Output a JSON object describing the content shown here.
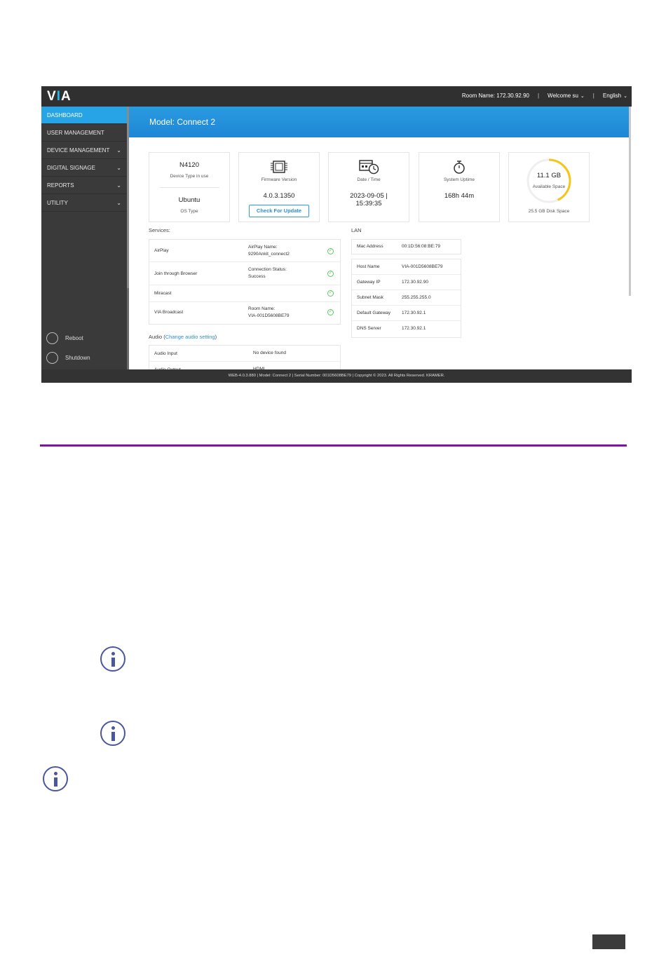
{
  "header": {
    "logo": "VIA",
    "room_name": "Room Name: 172.30.92.90",
    "separator": "|",
    "welcome": "Welcome su",
    "language": "English"
  },
  "sidebar": {
    "items": [
      {
        "label": "DASHBOARD",
        "active": true,
        "expandable": false
      },
      {
        "label": "USER MANAGEMENT",
        "active": false,
        "expandable": false
      },
      {
        "label": "DEVICE MANAGEMENT",
        "active": false,
        "expandable": true
      },
      {
        "label": "DIGITAL SIGNAGE",
        "active": false,
        "expandable": true
      },
      {
        "label": "REPORTS",
        "active": false,
        "expandable": true
      },
      {
        "label": "UTILITY",
        "active": false,
        "expandable": true
      }
    ],
    "reboot": "Reboot",
    "shutdown": "Shutdown"
  },
  "main": {
    "title": "Model: Connect 2",
    "cards": {
      "device": {
        "value": "N4120",
        "label": "Device Type in use",
        "os_value": "Ubuntu",
        "os_label": "OS Type"
      },
      "firmware": {
        "label": "Firmware Version",
        "value": "4.0.3.1350",
        "button": "Check For Update"
      },
      "datetime": {
        "label": "Date / Time",
        "line1": "2023-09-05 |",
        "line2": "15:39:35"
      },
      "uptime": {
        "label": "System Uptime",
        "value": "168h 44m"
      },
      "disk": {
        "available": "11.1 GB",
        "available_label": "Available Space",
        "total": "25.5 GB Disk Space",
        "used_fraction": 0.43
      }
    },
    "services": {
      "title": "Services:",
      "rows": [
        {
          "name": "AirPlay",
          "detail1": "AirPlay Name:",
          "detail2": "9290Ankit_connect2"
        },
        {
          "name": "Join through Browser",
          "detail1": "Connection Status:",
          "detail2": "Success"
        },
        {
          "name": "Miracast",
          "detail1": "",
          "detail2": ""
        },
        {
          "name": "VIA Broadcast",
          "detail1": "Room Name:",
          "detail2": "VIA-001D5608BE79"
        }
      ]
    },
    "audio": {
      "title": "Audio (",
      "link": "Change audio setting",
      "title_end": ")",
      "rows": [
        {
          "name": "Audio Input",
          "value": "No device found"
        },
        {
          "name": "Audio Output",
          "value": "HDMI"
        }
      ]
    },
    "lan": {
      "title": "LAN",
      "mac_label": "Mac Address",
      "mac_value": "00:1D:56:08:BE:79",
      "rows": [
        {
          "key": "Host Name",
          "value": "VIA-001D5608BE79"
        },
        {
          "key": "Gateway IP",
          "value": "172.30.92.90"
        },
        {
          "key": "Subnet Mask",
          "value": "255.255.255.0"
        },
        {
          "key": "Default Gateway",
          "value": "172.30.92.1"
        },
        {
          "key": "DNS Server",
          "value": "172.30.92.1"
        }
      ]
    }
  },
  "footer": {
    "text": "WEB-4.0.3.880 | Model: Connect 2 | Serial Number: 001D5608BE79 | Copyright © 2023. All Rights Reserved. KRAMER."
  },
  "colors": {
    "accent": "#27a4e5",
    "divider": "#7d14a8",
    "disk_ring": "#f5c518",
    "check": "#5cc85c",
    "info_icon": "#4b56a0"
  }
}
